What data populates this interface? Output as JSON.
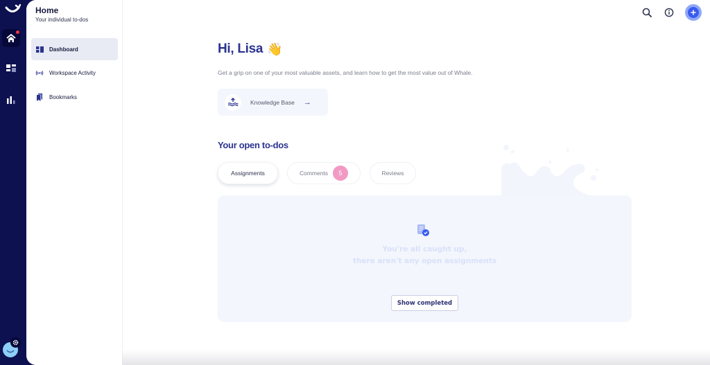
{
  "rail": {
    "icons": [
      "whale-logo-icon",
      "home-icon",
      "grid-icon",
      "bar-chart-icon",
      "avatar",
      "gear-icon"
    ],
    "notification_color": "#f0344a"
  },
  "sidebar": {
    "title": "Home",
    "subtitle": "Your individual to-dos",
    "items": [
      {
        "label": "Dashboard",
        "icon": "dashboard-icon",
        "active": true
      },
      {
        "label": "Workspace Activity",
        "icon": "broadcast-icon",
        "active": false
      },
      {
        "label": "Bookmarks",
        "icon": "bookmark-icon",
        "active": false
      }
    ]
  },
  "topbar": {
    "icons": [
      "search-icon",
      "info-icon",
      "plus-icon"
    ],
    "accent": "#3a5bf0"
  },
  "main": {
    "greeting": "Hi, Lisa",
    "greeting_emoji": "👋",
    "intro": "Get a grip on one of your most valuable assets, and learn how to get the most value out of Whale.",
    "knowledge_base": {
      "label": "Knowledge Base",
      "arrow": "→",
      "icon": "wave-upload-icon"
    },
    "todos": {
      "title": "Your open to-dos",
      "tabs": [
        {
          "label": "Assignments",
          "active": true
        },
        {
          "label": "Comments",
          "badge": "5",
          "badge_color": "#f19ac4"
        },
        {
          "label": "Reviews"
        }
      ],
      "empty": {
        "line1": "You're all caught up,",
        "line2": "there aren't any open assignments",
        "button": "Show completed"
      }
    }
  },
  "colors": {
    "rail_bg": "#0d1150",
    "title_blue": "#2b338f",
    "card_bg": "#f3f6fc"
  }
}
